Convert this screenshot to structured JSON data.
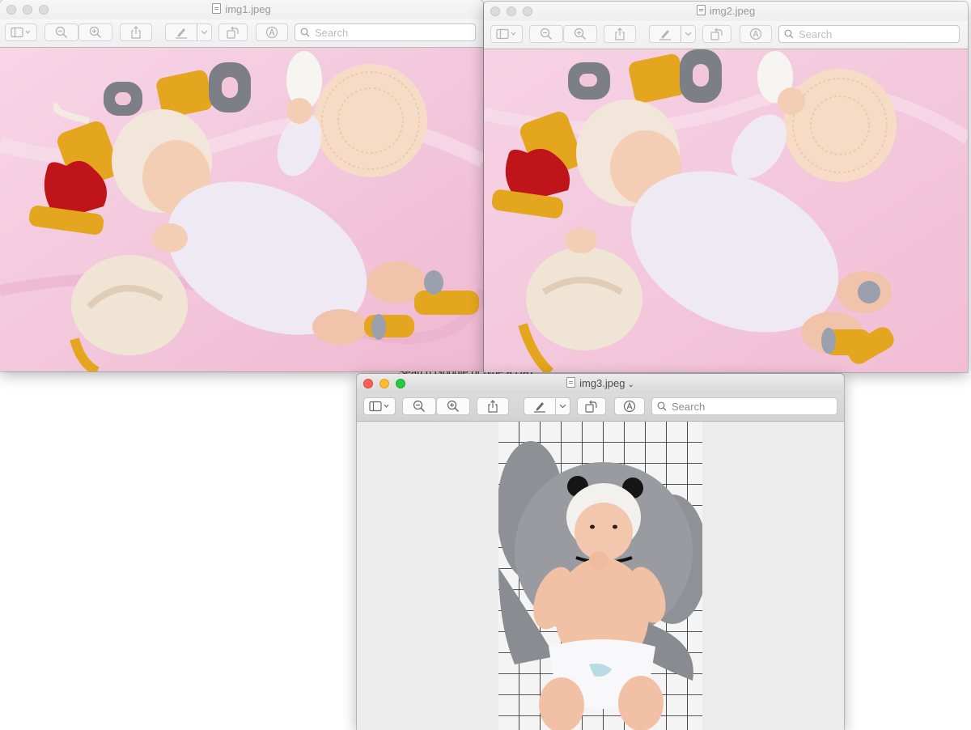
{
  "background": {
    "partial_text": "Search Google or type a URL"
  },
  "windows": [
    {
      "id": "win1",
      "title": "img1.jpeg",
      "active": false,
      "search_placeholder": "Search",
      "has_title_menu": false,
      "image_desc": "baby lying on pink blanket with crocheted MOMO letters, heart and pillows"
    },
    {
      "id": "win2",
      "title": "img2.jpeg",
      "active": false,
      "search_placeholder": "Search",
      "has_title_menu": false,
      "image_desc": "baby lying on pink blanket, alternate pose"
    },
    {
      "id": "win3",
      "title": "img3.jpeg",
      "active": true,
      "search_placeholder": "Search",
      "has_title_menu": true,
      "image_desc": "baby in panda hat on grey elephant plush over black-and-white grid blanket"
    }
  ],
  "colors": {
    "close": "#fe5f57",
    "minimize": "#febc2e",
    "maximize": "#28c840",
    "pink_bg": "#f3c9dc",
    "mustard": "#e2a51f",
    "grey_plush": "#8e8e92"
  }
}
